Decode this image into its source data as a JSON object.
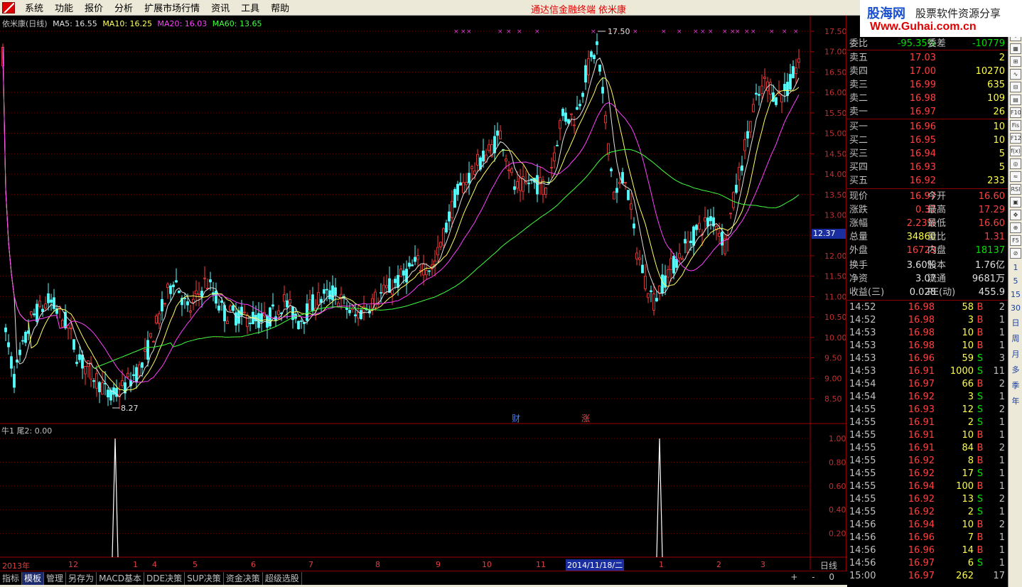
{
  "menu": {
    "items": [
      "系统",
      "功能",
      "报价",
      "分析",
      "扩展市场行情",
      "资讯",
      "工具",
      "帮助"
    ],
    "terminal_title": "通达信金融终端",
    "stock_title": "依米康"
  },
  "banner": {
    "site_cn": "股海网",
    "slogan": "股票软件资源分享",
    "url": "Www.Guhai.com.cn"
  },
  "legend": {
    "name": "依米康(日线)",
    "ma5": "MA5: 16.55",
    "ma10": "MA10: 16.25",
    "ma20": "MA20: 16.03",
    "ma60": "MA60: 13.65"
  },
  "indicator_legend": "牛1  尾2: 0.00",
  "price_axis": [
    "17.50",
    "17.00",
    "16.50",
    "16.00",
    "15.50",
    "15.00",
    "14.50",
    "14.00",
    "13.50",
    "13.00",
    "12.50",
    "12.00",
    "11.50",
    "11.00",
    "10.50",
    "10.00",
    "9.50",
    "9.00",
    "8.50"
  ],
  "ind_axis": [
    "1.00",
    "0.80",
    "0.60",
    "0.40",
    "0.20"
  ],
  "current_price_tag": "12.37",
  "high_label": "17.50",
  "low_label": "8.27",
  "tag_cai": "财",
  "tag_zhang": "涨",
  "x_labels": [
    {
      "t": "2013年"
    },
    {
      "t": "12"
    },
    {
      "t": "1"
    },
    {
      "t": "4"
    },
    {
      "t": "5"
    },
    {
      "t": "6"
    },
    {
      "t": "7"
    },
    {
      "t": "8"
    },
    {
      "t": "9"
    },
    {
      "t": "10"
    },
    {
      "t": "11"
    },
    {
      "t": "1"
    },
    {
      "t": "2"
    },
    {
      "t": "3"
    }
  ],
  "selected_date": "2014/11/18/二",
  "period": "日线",
  "order_book": {
    "weibi_label": "委比",
    "weibi": "-95.35%",
    "weicha_label": "委差",
    "weicha": "-10779",
    "asks": [
      {
        "l": "卖五",
        "p": "17.03",
        "v": "2"
      },
      {
        "l": "卖四",
        "p": "17.00",
        "v": "10270"
      },
      {
        "l": "卖三",
        "p": "16.99",
        "v": "635"
      },
      {
        "l": "卖二",
        "p": "16.98",
        "v": "109"
      },
      {
        "l": "卖一",
        "p": "16.97",
        "v": "26"
      }
    ],
    "bids": [
      {
        "l": "买一",
        "p": "16.96",
        "v": "10"
      },
      {
        "l": "买二",
        "p": "16.95",
        "v": "10"
      },
      {
        "l": "买三",
        "p": "16.94",
        "v": "5"
      },
      {
        "l": "买四",
        "p": "16.93",
        "v": "5"
      },
      {
        "l": "买五",
        "p": "16.92",
        "v": "233"
      }
    ]
  },
  "quote": [
    {
      "l1": "现价",
      "v1": "16.97",
      "c1": "red",
      "l2": "今开",
      "v2": "16.60",
      "c2": "red"
    },
    {
      "l1": "涨跌",
      "v1": "0.37",
      "c1": "red",
      "l2": "最高",
      "v2": "17.29",
      "c2": "red"
    },
    {
      "l1": "涨幅",
      "v1": "2.23%",
      "c1": "red",
      "l2": "最低",
      "v2": "16.60",
      "c2": "red"
    },
    {
      "l1": "总量",
      "v1": "34860",
      "c1": "yellow",
      "l2": "量比",
      "v2": "1.31",
      "c2": "red"
    },
    {
      "l1": "外盘",
      "v1": "16723",
      "c1": "red",
      "l2": "内盘",
      "v2": "18137",
      "c2": "green"
    },
    {
      "l1": "换手",
      "v1": "3.60%",
      "c1": "white",
      "l2": "股本",
      "v2": "1.76亿",
      "c2": "white"
    },
    {
      "l1": "净资",
      "v1": "3.07",
      "c1": "white",
      "l2": "流通",
      "v2": "9681万",
      "c2": "white"
    },
    {
      "l1": "收益(三)",
      "v1": "0.028",
      "c1": "white",
      "l2": "PE(动)",
      "v2": "455.9",
      "c2": "white"
    }
  ],
  "ticks": [
    {
      "t": "14:52",
      "p": "16.98",
      "v": "58",
      "bs": "B",
      "n": "2"
    },
    {
      "t": "14:52",
      "p": "16.98",
      "v": "3",
      "bs": "B",
      "n": "1"
    },
    {
      "t": "14:53",
      "p": "16.98",
      "v": "10",
      "bs": "B",
      "n": "1"
    },
    {
      "t": "14:53",
      "p": "16.98",
      "v": "10",
      "bs": "B",
      "n": "1"
    },
    {
      "t": "14:53",
      "p": "16.96",
      "v": "59",
      "bs": "S",
      "n": "3"
    },
    {
      "t": "14:53",
      "p": "16.91",
      "v": "1000",
      "bs": "S",
      "n": "11"
    },
    {
      "t": "14:54",
      "p": "16.97",
      "v": "66",
      "bs": "B",
      "n": "2"
    },
    {
      "t": "14:54",
      "p": "16.92",
      "v": "3",
      "bs": "S",
      "n": "1"
    },
    {
      "t": "14:55",
      "p": "16.93",
      "v": "12",
      "bs": "S",
      "n": "2"
    },
    {
      "t": "14:55",
      "p": "16.91",
      "v": "2",
      "bs": "S",
      "n": "1"
    },
    {
      "t": "14:55",
      "p": "16.91",
      "v": "10",
      "bs": "B",
      "n": "1"
    },
    {
      "t": "14:55",
      "p": "16.91",
      "v": "84",
      "bs": "B",
      "n": "2"
    },
    {
      "t": "14:55",
      "p": "16.92",
      "v": "8",
      "bs": "B",
      "n": "1"
    },
    {
      "t": "14:55",
      "p": "16.92",
      "v": "17",
      "bs": "S",
      "n": "1"
    },
    {
      "t": "14:55",
      "p": "16.94",
      "v": "100",
      "bs": "B",
      "n": "1"
    },
    {
      "t": "14:55",
      "p": "16.92",
      "v": "13",
      "bs": "S",
      "n": "2"
    },
    {
      "t": "14:55",
      "p": "16.92",
      "v": "2",
      "bs": "S",
      "n": "1"
    },
    {
      "t": "14:56",
      "p": "16.94",
      "v": "10",
      "bs": "B",
      "n": "2"
    },
    {
      "t": "14:56",
      "p": "16.96",
      "v": "7",
      "bs": "B",
      "n": "1"
    },
    {
      "t": "14:56",
      "p": "16.96",
      "v": "14",
      "bs": "B",
      "n": "1"
    },
    {
      "t": "14:56",
      "p": "16.97",
      "v": "6",
      "bs": "S",
      "n": "1"
    },
    {
      "t": "15:00",
      "p": "16.97",
      "v": "262",
      "bs": "",
      "n": "17"
    }
  ],
  "tabs": [
    "指标",
    "模板",
    "管理",
    "另存为",
    "MACD基本",
    "DDE决策",
    "SUP决策",
    "资金决策",
    "超级选股"
  ],
  "tab_right": "+ - 0",
  "side_tools": [
    "⇧",
    "⇩",
    "▦",
    "⊞",
    "∿",
    "⊟",
    "▤",
    "F10",
    "Fis",
    "F12",
    "f(x)",
    "◎",
    "≈",
    "RSI",
    "▣",
    "✥",
    "⊕",
    "F5",
    "⊘"
  ],
  "side_periods": [
    "1",
    "5",
    "15",
    "30",
    "日",
    "周",
    "月",
    "多",
    "季",
    "年"
  ],
  "chart_data": {
    "type": "candlestick",
    "period": "daily",
    "high": 17.5,
    "low": 8.27,
    "last_close": 16.97,
    "ma5": 16.55,
    "ma10": 16.25,
    "ma20": 16.03,
    "ma60": 13.65,
    "indicator_spikes": [
      1.0,
      1.0
    ]
  }
}
